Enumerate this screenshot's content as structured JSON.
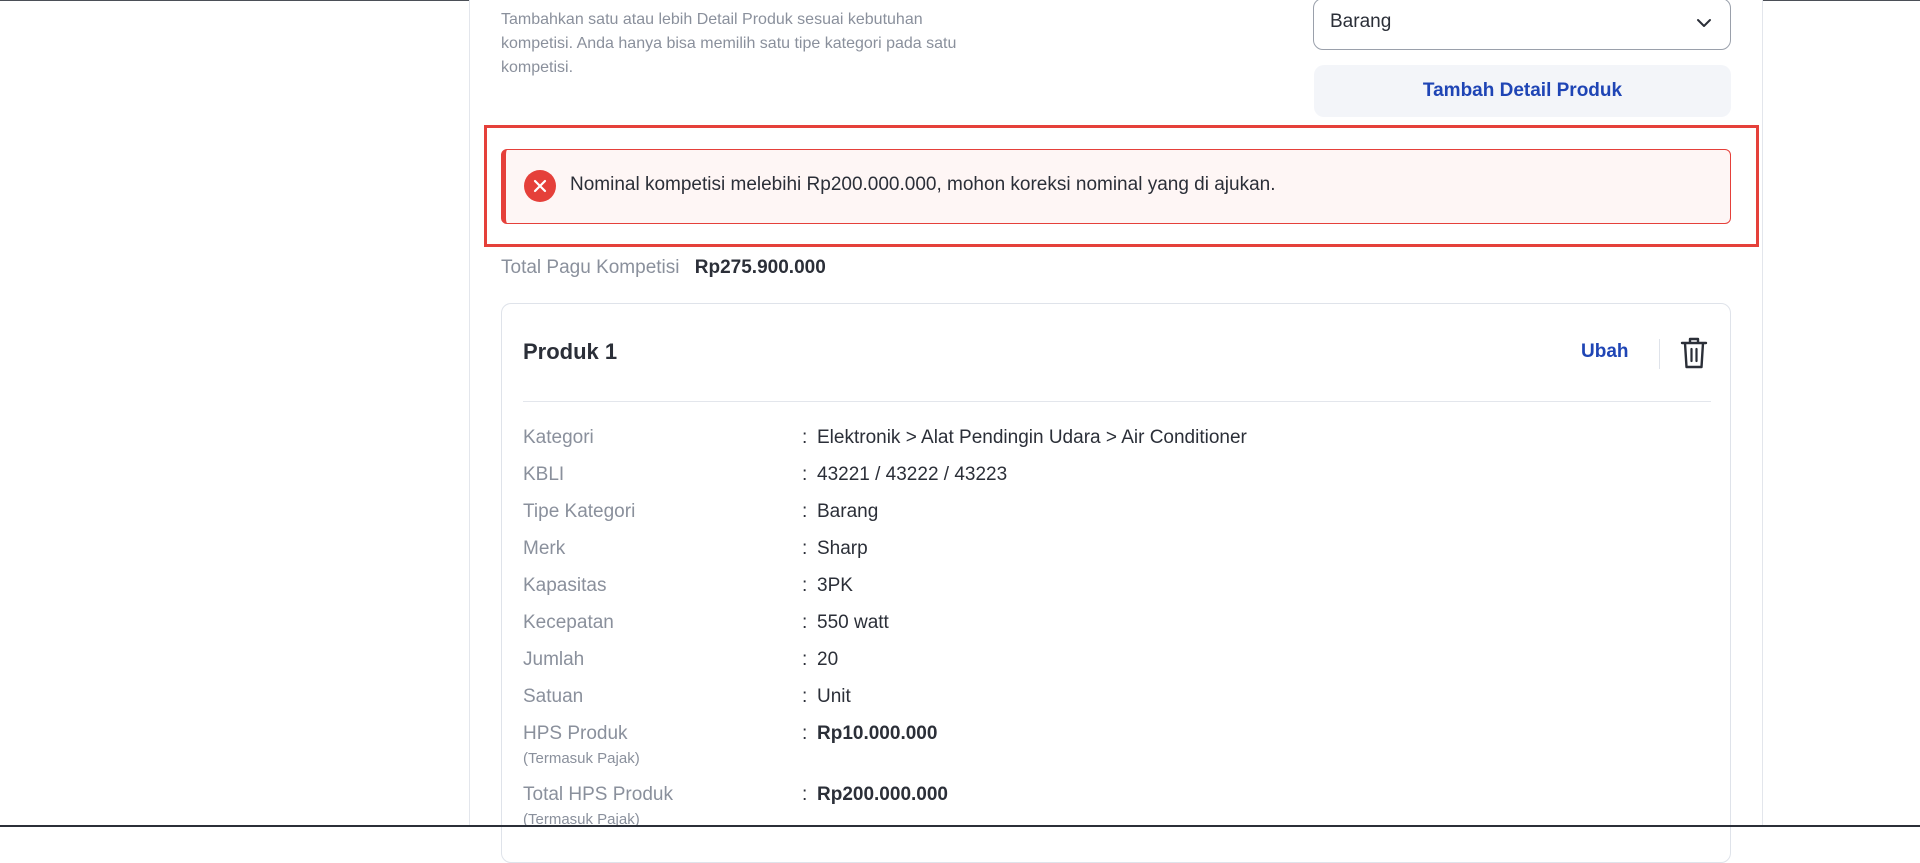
{
  "description": "Tambahkan satu atau lebih Detail Produk sesuai kebutuhan kompetisi. Anda hanya bisa memilih satu tipe kategori pada satu kompetisi.",
  "category_select": {
    "value": "Barang"
  },
  "add_detail_button": "Tambah Detail Produk",
  "alert": {
    "message": "Nominal kompetisi melebihi Rp200.000.000, mohon koreksi nominal yang di ajukan.",
    "color": "#e5403a"
  },
  "total": {
    "label": "Total Pagu Kompetisi",
    "amount": "Rp275.900.000"
  },
  "product": {
    "title": "Produk 1",
    "edit_label": "Ubah",
    "specs": [
      {
        "key": "Kategori",
        "value": "Elektronik > Alat Pendingin Udara > Air Conditioner"
      },
      {
        "key": "KBLI",
        "value": "43221 / 43222 / 43223"
      },
      {
        "key": "Tipe Kategori",
        "value": "Barang"
      },
      {
        "key": "Merk",
        "value": "Sharp"
      },
      {
        "key": "Kapasitas",
        "value": "3PK"
      },
      {
        "key": "Kecepatan",
        "value": "550 watt"
      },
      {
        "key": "Jumlah",
        "value": "20"
      },
      {
        "key": "Satuan",
        "value": "Unit"
      },
      {
        "key": "HPS Produk",
        "sub": "(Termasuk Pajak)",
        "value": "Rp10.000.000"
      },
      {
        "key": "Total HPS Produk",
        "sub": "(Termasuk Pajak)",
        "value": "Rp200.000.000"
      }
    ],
    "colon": ":"
  },
  "colors": {
    "accent": "#1f45b5",
    "error": "#e5403a",
    "muted": "#8a909c"
  }
}
